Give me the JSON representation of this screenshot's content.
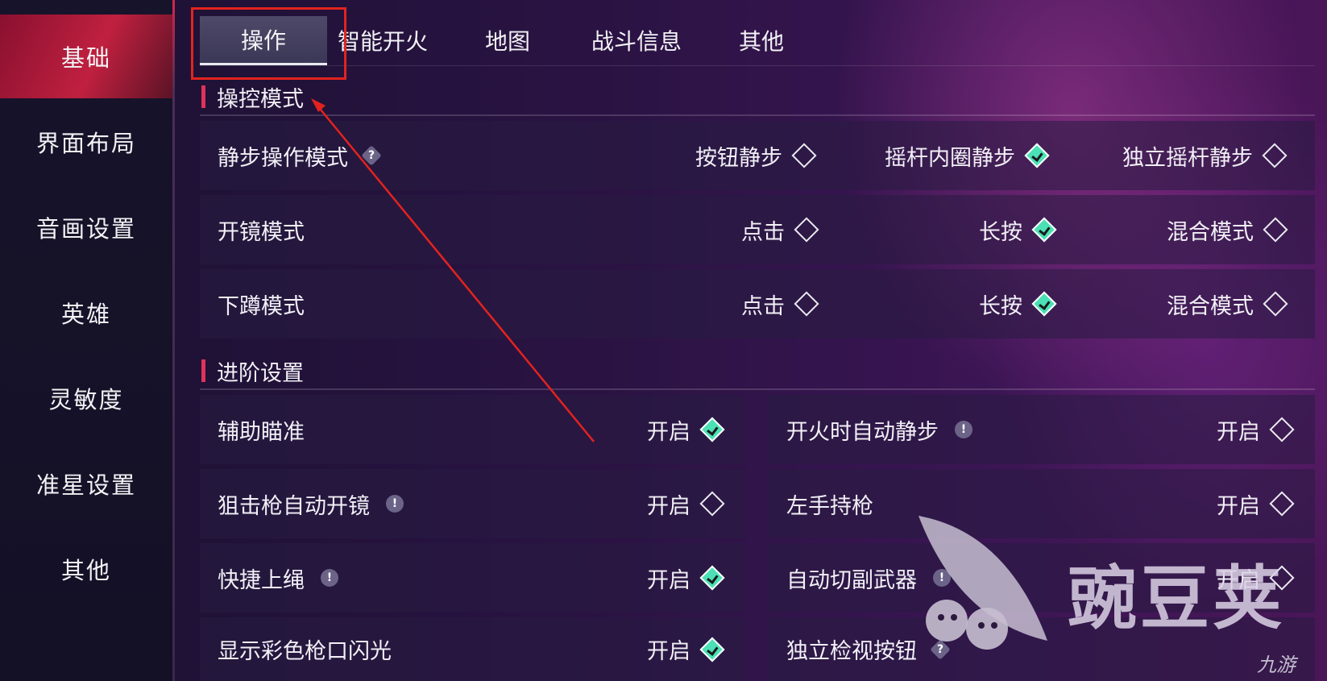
{
  "sidebar": {
    "items": [
      {
        "label": "基础",
        "active": true
      },
      {
        "label": "界面布局",
        "active": false
      },
      {
        "label": "音画设置",
        "active": false
      },
      {
        "label": "英雄",
        "active": false
      },
      {
        "label": "灵敏度",
        "active": false
      },
      {
        "label": "准星设置",
        "active": false
      },
      {
        "label": "其他",
        "active": false
      }
    ]
  },
  "tabs": [
    {
      "label": "操作",
      "active": true
    },
    {
      "label": "智能开火",
      "active": false
    },
    {
      "label": "地图",
      "active": false
    },
    {
      "label": "战斗信息",
      "active": false
    },
    {
      "label": "其他",
      "active": false
    }
  ],
  "control_mode": {
    "title": "操控模式",
    "rows": [
      {
        "label": "静步操作模式",
        "badge": "?",
        "options": [
          {
            "label": "按钮静步",
            "selected": false
          },
          {
            "label": "摇杆内圈静步",
            "selected": true
          },
          {
            "label": "独立摇杆静步",
            "selected": false
          }
        ]
      },
      {
        "label": "开镜模式",
        "options": [
          {
            "label": "点击",
            "selected": false
          },
          {
            "label": "长按",
            "selected": true
          },
          {
            "label": "混合模式",
            "selected": false
          }
        ]
      },
      {
        "label": "下蹲模式",
        "options": [
          {
            "label": "点击",
            "selected": false
          },
          {
            "label": "长按",
            "selected": true
          },
          {
            "label": "混合模式",
            "selected": false
          }
        ]
      }
    ]
  },
  "advanced": {
    "title": "进阶设置",
    "left": [
      {
        "label": "辅助瞄准",
        "badge": "",
        "toggle": "开启",
        "on": true
      },
      {
        "label": "狙击枪自动开镜",
        "badge": "!",
        "toggle": "开启",
        "on": false
      },
      {
        "label": "快捷上绳",
        "badge": "!",
        "toggle": "开启",
        "on": true
      },
      {
        "label": "显示彩色枪口闪光",
        "badge": "",
        "toggle": "开启",
        "on": true
      }
    ],
    "right": [
      {
        "label": "开火时自动静步",
        "badge": "!",
        "toggle": "开启",
        "on": false
      },
      {
        "label": "左手持枪",
        "badge": "",
        "toggle": "开启",
        "on": false
      },
      {
        "label": "自动切副武器",
        "badge": "!",
        "toggle": "开启",
        "on": false
      },
      {
        "label": "独立检视按钮",
        "badge": "?",
        "toggle": "",
        "on": false
      }
    ]
  },
  "watermark": {
    "brand": "豌豆荚",
    "secondary": "九游"
  },
  "colors": {
    "accent_red": "#e3231e",
    "selected": "#4be0b6",
    "sidebar_active": "#c0203f"
  }
}
